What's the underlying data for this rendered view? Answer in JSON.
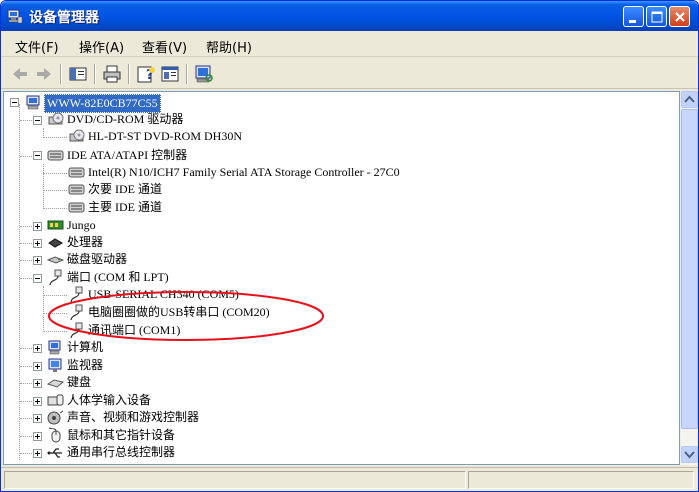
{
  "window": {
    "title": "设备管理器",
    "accent": "#0054e3"
  },
  "menu": [
    {
      "label": "文件(F)"
    },
    {
      "label": "操作(A)"
    },
    {
      "label": "查看(V)"
    },
    {
      "label": "帮助(H)"
    }
  ],
  "toolbar": [
    {
      "icon": "back-arrow-icon"
    },
    {
      "icon": "forward-arrow-icon"
    },
    {
      "icon": "show-hide-console-tree-icon"
    },
    {
      "icon": "print-icon"
    },
    {
      "icon": "help-icon"
    },
    {
      "icon": "properties-icon"
    },
    {
      "icon": "scan-hardware-icon"
    }
  ],
  "tree": {
    "root": "WWW-82E0CB77C55",
    "items": [
      {
        "label": "DVD/CD-ROM 驱动器",
        "icon": "dvd-drive-icon"
      },
      {
        "label": "HL-DT-ST DVD-ROM DH30N",
        "icon": "dvd-drive-icon"
      },
      {
        "label": "IDE ATA/ATAPI 控制器",
        "icon": "ide-controller-icon"
      },
      {
        "label": "Intel(R) N10/ICH7 Family Serial ATA Storage Controller - 27C0",
        "icon": "ide-controller-icon"
      },
      {
        "label": "次要 IDE 通道",
        "icon": "ide-controller-icon"
      },
      {
        "label": "主要 IDE 通道",
        "icon": "ide-controller-icon"
      },
      {
        "label": "Jungo",
        "icon": "jungo-icon"
      },
      {
        "label": "处理器",
        "icon": "processor-icon"
      },
      {
        "label": "磁盘驱动器",
        "icon": "disk-drive-icon"
      },
      {
        "label": "端口 (COM 和 LPT)",
        "icon": "port-icon"
      },
      {
        "label": "USB-SERIAL CH340 (COM5)",
        "icon": "port-icon"
      },
      {
        "label": "电脑圈圈做的USB转串口 (COM20)",
        "icon": "port-icon"
      },
      {
        "label": "通讯端口 (COM1)",
        "icon": "port-icon"
      },
      {
        "label": "计算机",
        "icon": "computer-icon"
      },
      {
        "label": "监视器",
        "icon": "monitor-icon"
      },
      {
        "label": "键盘",
        "icon": "keyboard-icon"
      },
      {
        "label": "人体学输入设备",
        "icon": "hid-icon"
      },
      {
        "label": "声音、视频和游戏控制器",
        "icon": "sound-icon"
      },
      {
        "label": "鼠标和其它指针设备",
        "icon": "mouse-icon"
      },
      {
        "label": "通用串行总线控制器",
        "icon": "usb-icon"
      }
    ]
  }
}
